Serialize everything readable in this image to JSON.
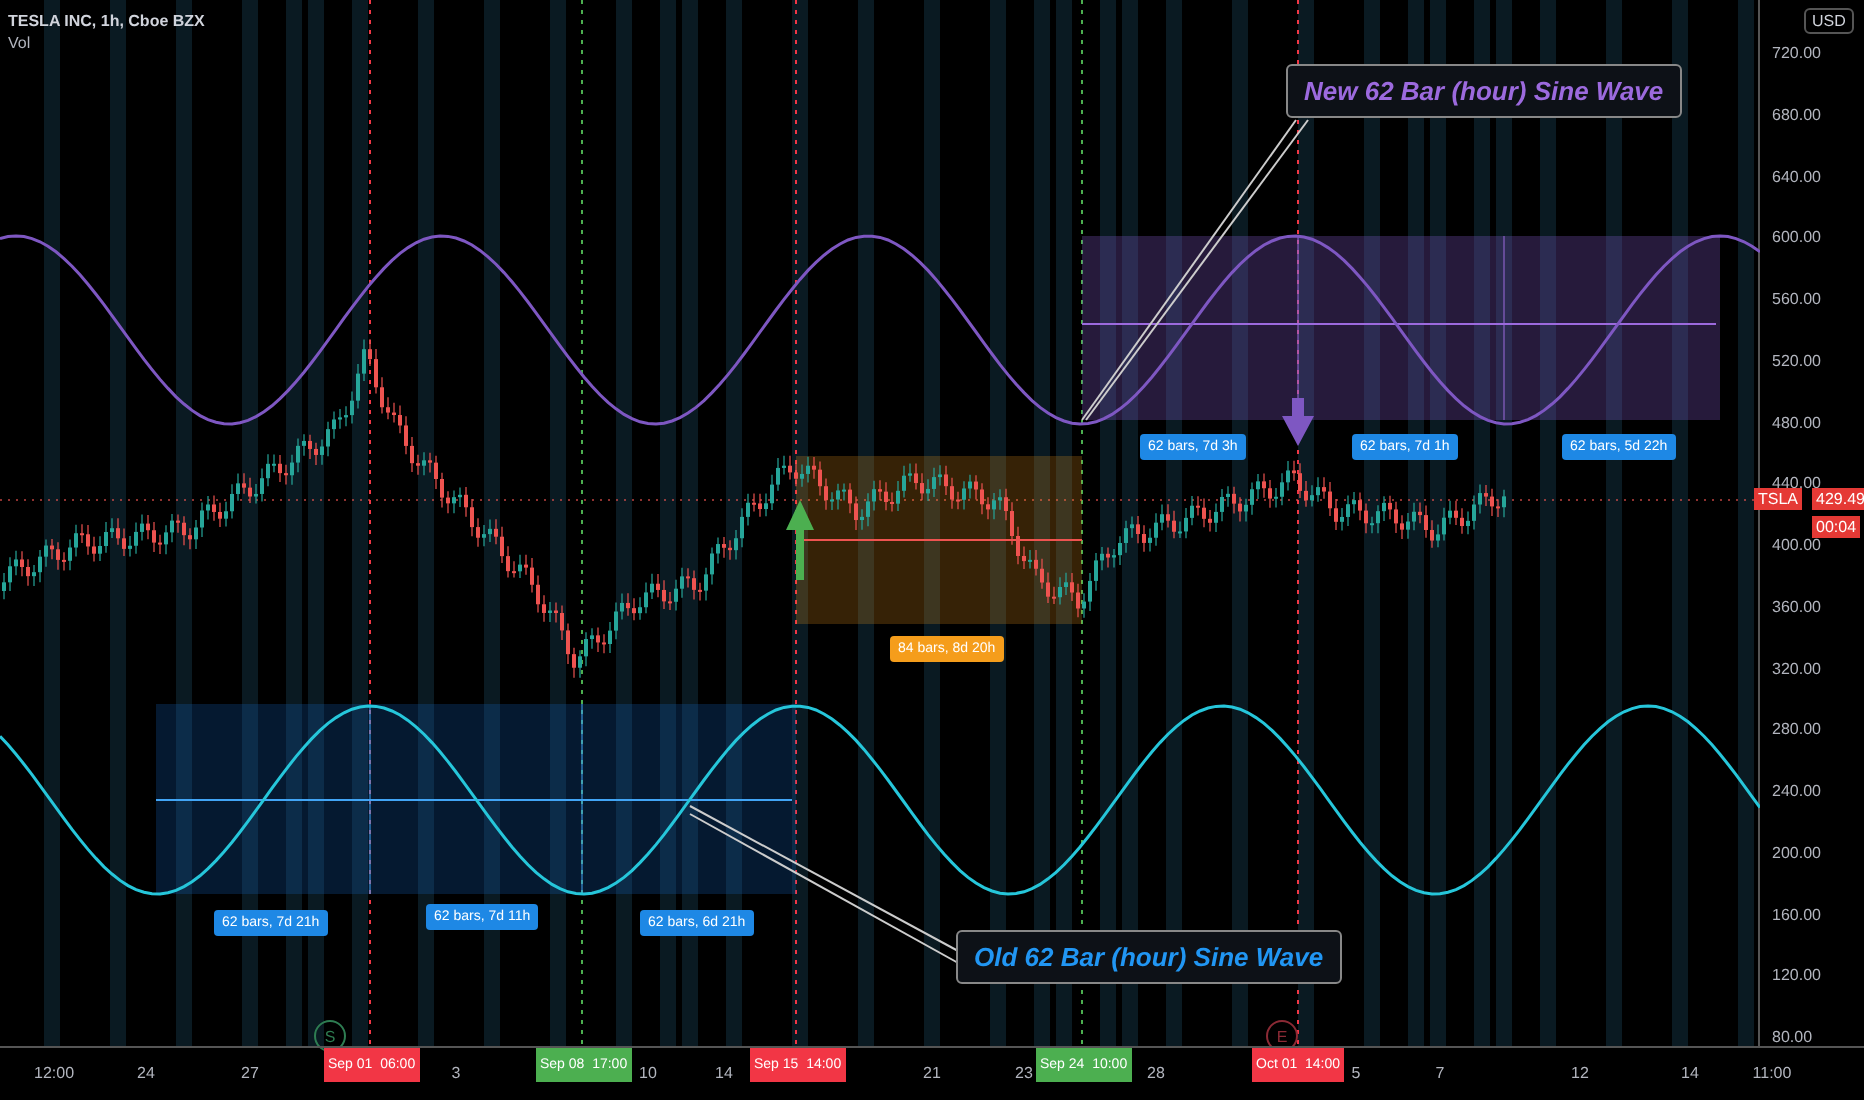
{
  "header": {
    "title": "TESLA INC, 1h, Cboe BZX",
    "indicator": "Vol"
  },
  "currency_button": "USD",
  "price_axis": [
    "720.00",
    "680.00",
    "640.00",
    "600.00",
    "560.00",
    "520.00",
    "480.00",
    "440.00",
    "400.00",
    "360.00",
    "320.00",
    "280.00",
    "240.00",
    "200.00",
    "160.00",
    "120.00",
    "80.00"
  ],
  "time_axis": [
    {
      "kind": "tick",
      "label": "12:00"
    },
    {
      "kind": "tick",
      "label": "24"
    },
    {
      "kind": "tick",
      "label": "27"
    },
    {
      "kind": "marker",
      "date": "Sep 01",
      "time": "06:00",
      "color": "#f23645"
    },
    {
      "kind": "tick",
      "label": "3"
    },
    {
      "kind": "marker",
      "date": "Sep 08",
      "time": "17:00",
      "color": "#4caf50"
    },
    {
      "kind": "tick",
      "label": "10"
    },
    {
      "kind": "tick",
      "label": "14"
    },
    {
      "kind": "marker",
      "date": "Sep 15",
      "time": "14:00",
      "color": "#f23645"
    },
    {
      "kind": "tick",
      "label": "21"
    },
    {
      "kind": "tick",
      "label": "23"
    },
    {
      "kind": "marker",
      "date": "Sep 24",
      "time": "10:00",
      "color": "#4caf50"
    },
    {
      "kind": "tick",
      "label": "28"
    },
    {
      "kind": "marker",
      "date": "Oct 01",
      "time": "14:00",
      "color": "#f23645"
    },
    {
      "kind": "tick",
      "label": "5"
    },
    {
      "kind": "tick",
      "label": "7"
    },
    {
      "kind": "tick",
      "label": "12"
    },
    {
      "kind": "tick",
      "label": "14"
    },
    {
      "kind": "tick",
      "label": "11:00"
    }
  ],
  "events": [
    {
      "label": "S",
      "color": "#2e7d52"
    },
    {
      "label": "E",
      "color": "#8b2a35"
    }
  ],
  "price_tag": {
    "symbol": "TSLA",
    "price": "429.49",
    "countdown": "00:04"
  },
  "measure_labels": [
    {
      "text": "62 bars, 7d 21h",
      "color": "#1e88e5"
    },
    {
      "text": "62 bars, 7d 11h",
      "color": "#1e88e5"
    },
    {
      "text": "62 bars, 6d 21h",
      "color": "#1e88e5"
    },
    {
      "text": "84 bars, 8d 20h",
      "color": "#f59d1b"
    },
    {
      "text": "62 bars, 7d 3h",
      "color": "#1e88e5"
    },
    {
      "text": "62 bars, 7d 1h",
      "color": "#1e88e5"
    },
    {
      "text": "62 bars, 5d 22h",
      "color": "#1e88e5"
    }
  ],
  "callouts": [
    {
      "text": "New 62 Bar (hour) Sine Wave",
      "color": "#9c6ade"
    },
    {
      "text": "Old 62 Bar (hour) Sine Wave",
      "color": "#2196f3"
    }
  ]
}
